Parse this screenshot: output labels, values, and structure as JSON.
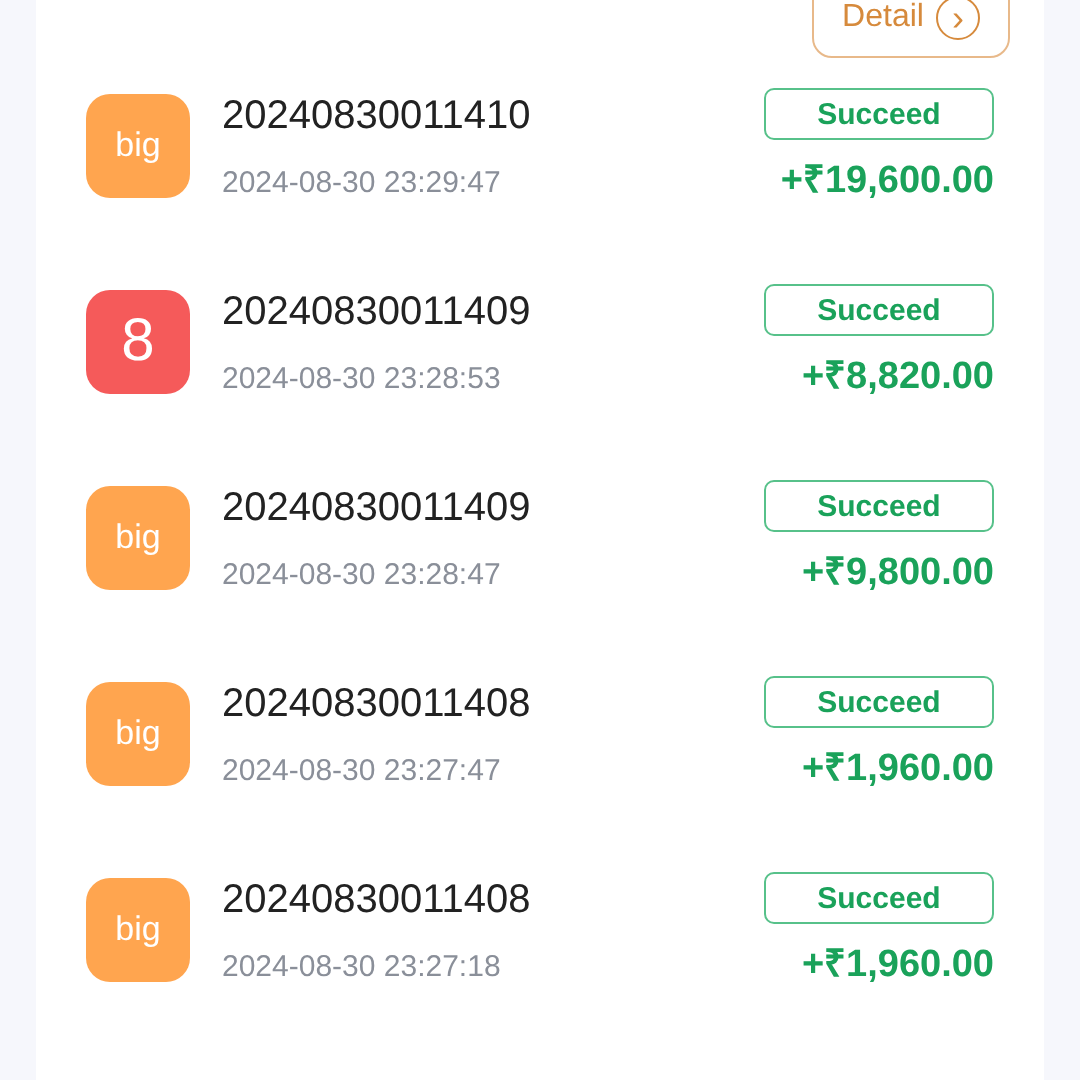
{
  "detail_button": {
    "label": "Detail",
    "icon": "›"
  },
  "records": [
    {
      "badge": {
        "text": "big",
        "color": "#ffa54f"
      },
      "order_no": "20240830011410",
      "time": "2024-08-30 23:29:47",
      "status": "Succeed",
      "amount": "+₹19,600.00"
    },
    {
      "badge": {
        "text": "8",
        "color": "#f55a5a"
      },
      "order_no": "20240830011409",
      "time": "2024-08-30 23:28:53",
      "status": "Succeed",
      "amount": "+₹8,820.00"
    },
    {
      "badge": {
        "text": "big",
        "color": "#ffa54f"
      },
      "order_no": "20240830011409",
      "time": "2024-08-30 23:28:47",
      "status": "Succeed",
      "amount": "+₹9,800.00"
    },
    {
      "badge": {
        "text": "big",
        "color": "#ffa54f"
      },
      "order_no": "20240830011408",
      "time": "2024-08-30 23:27:47",
      "status": "Succeed",
      "amount": "+₹1,960.00"
    },
    {
      "badge": {
        "text": "big",
        "color": "#ffa54f"
      },
      "order_no": "20240830011408",
      "time": "2024-08-30 23:27:18",
      "status": "Succeed",
      "amount": "+₹1,960.00"
    }
  ]
}
